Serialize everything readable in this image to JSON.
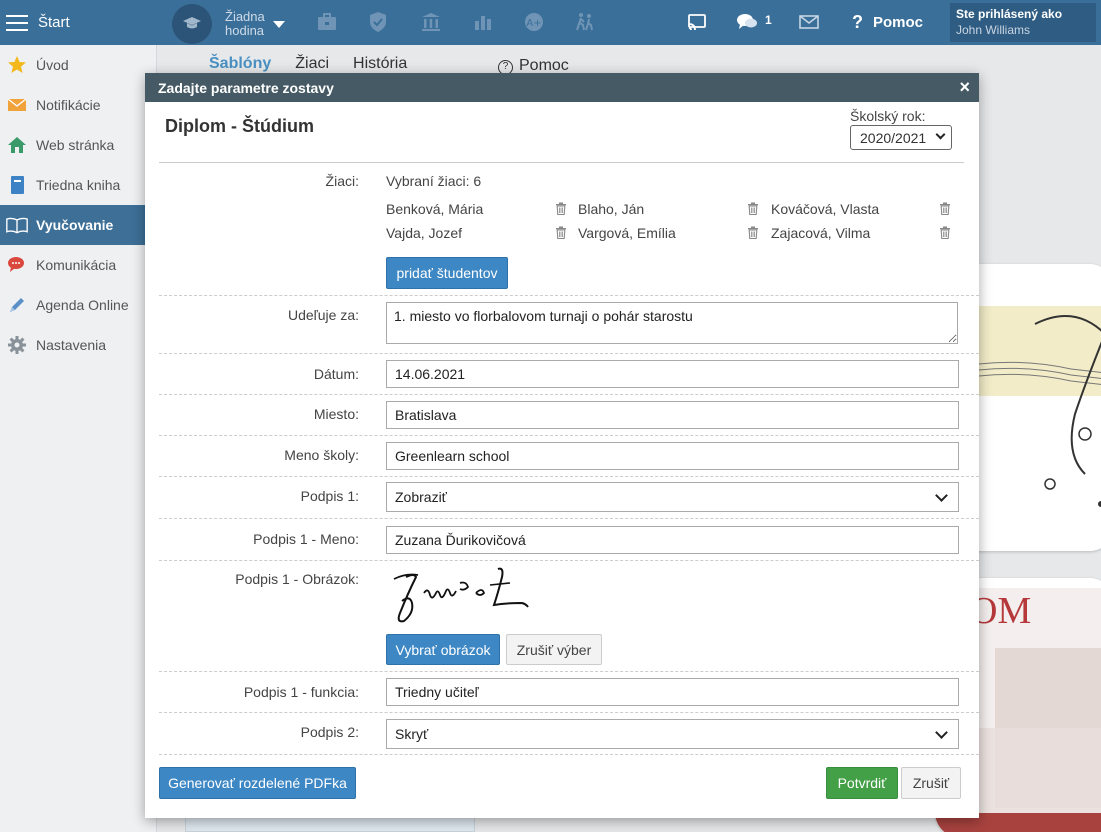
{
  "topbar": {
    "start_label": "Štart",
    "hour_line1": "Žiadna",
    "hour_line2": "hodina",
    "chat_count": "1",
    "help_label": "Pomoc",
    "user_caption": "Ste prihlásený ako",
    "user_name": "John Williams"
  },
  "sidebar": {
    "items": [
      {
        "label": "Úvod",
        "icon": "star-icon"
      },
      {
        "label": "Notifikácie",
        "icon": "envelope-icon"
      },
      {
        "label": "Web stránka",
        "icon": "house-icon"
      },
      {
        "label": "Triedna kniha",
        "icon": "book-icon"
      },
      {
        "label": "Vyučovanie",
        "icon": "open-book-icon"
      },
      {
        "label": "Komunikácia",
        "icon": "chat-icon"
      },
      {
        "label": "Agenda Online",
        "icon": "pen-icon"
      },
      {
        "label": "Nastavenia",
        "icon": "gear-icon"
      }
    ],
    "active_index": 4
  },
  "background": {
    "tabs": [
      "Šablóny",
      "Žiaci",
      "História"
    ],
    "help_label": "Pomoc"
  },
  "modal": {
    "header_title": "Zadajte parametre zostavy",
    "close_symbol": "×",
    "title": "Diplom - Štúdium",
    "year_label": "Školský rok:",
    "year_value": "2020/2021",
    "students_label": "Žiaci:",
    "students_count": "Vybraní žiaci: 6",
    "students": [
      "Benková, Mária",
      "Blaho, Ján",
      "Kováčová, Vlasta",
      "Vajda, Jozef",
      "Vargová, Emília",
      "Zajacová, Vilma"
    ],
    "add_students_label": "pridať študentov",
    "award_label": "Udeľuje za:",
    "award_value": "1. miesto vo florbalovom turnaji o pohár starostu",
    "date_label": "Dátum:",
    "date_value": "14.06.2021",
    "place_label": "Miesto:",
    "place_value": "Bratislava",
    "school_label": "Meno školy:",
    "school_value": "Greenlearn school",
    "sig1_label": "Podpis 1:",
    "sig1_value": "Zobraziť",
    "sig1_name_label": "Podpis 1 - Meno:",
    "sig1_name_value": "Zuzana Ďurikovičová",
    "sig1_image_label": "Podpis 1 - Obrázok:",
    "choose_image_label": "Vybrať obrázok",
    "cancel_selection_label": "Zrušiť výber",
    "sig1_role_label": "Podpis 1 - funkcia:",
    "sig1_role_value": "Triedny učiteľ",
    "sig2_label": "Podpis 2:",
    "sig2_value": "Skryť",
    "generate_label": "Generovať rozdelené PDFka",
    "confirm_label": "Potvrdiť",
    "cancel_label": "Zrušiť"
  },
  "colors": {
    "topbar": "#3a6f9a",
    "modal_header": "#455a64",
    "primary_button": "#3d87c4",
    "confirm_button": "#43a047"
  }
}
